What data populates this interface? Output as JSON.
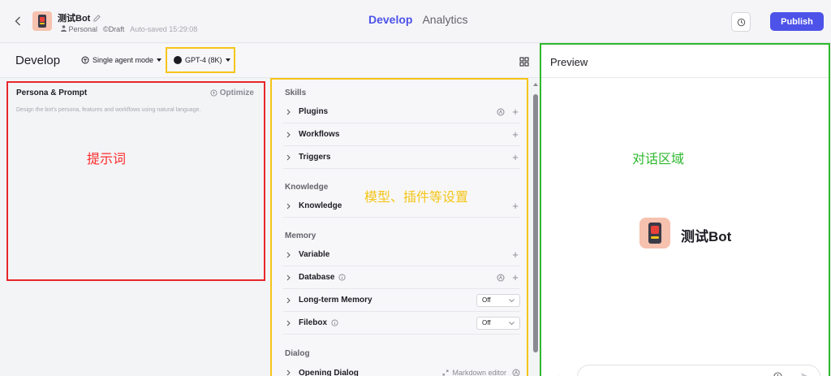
{
  "topbar": {
    "bot_name": "测试Bot",
    "workspace": "Personal",
    "status": "Draft",
    "autosave": "Auto-saved 15:29:08",
    "nav": [
      {
        "label": "Develop",
        "active": true
      },
      {
        "label": "Analytics",
        "active": false
      }
    ],
    "publish_label": "Publish",
    "accent_color": "#4d53e8"
  },
  "develop": {
    "title": "Develop",
    "mode": "Single agent mode",
    "model": "GPT-4 (8K)"
  },
  "prompt": {
    "title": "Persona & Prompt",
    "optimize_label": "Optimize",
    "placeholder": "Design the bot's persona, features and workflows using natural language.",
    "annotation": "提示词",
    "annotation_color": "#e8262b"
  },
  "settings": {
    "annotation": "模型、插件等设置",
    "annotation_color": "#f5c518",
    "sections": [
      {
        "title": "Skills",
        "items": [
          {
            "label": "Plugins",
            "auto": true,
            "add": true
          },
          {
            "label": "Workflows",
            "add": true
          },
          {
            "label": "Triggers",
            "add": true
          }
        ]
      },
      {
        "title": "Knowledge",
        "items": [
          {
            "label": "Knowledge",
            "add": true
          }
        ]
      },
      {
        "title": "Memory",
        "items": [
          {
            "label": "Variable",
            "add": true
          },
          {
            "label": "Database",
            "info": true,
            "auto": true,
            "add": true
          },
          {
            "label": "Long-term Memory",
            "toggle": "Off"
          },
          {
            "label": "Filebox",
            "info": true,
            "toggle": "Off"
          }
        ]
      },
      {
        "title": "Dialog",
        "items": [
          {
            "label": "Opening Dialog",
            "extra": "Markdown editor"
          }
        ]
      }
    ]
  },
  "preview": {
    "title": "Preview",
    "annotation": "对话区域",
    "annotation_color": "#2eb82e",
    "bot_name": "测试Bot"
  },
  "icons": {
    "back": "chevron-left-icon",
    "edit": "edit-icon",
    "history": "history-icon",
    "grid": "grid-icon",
    "optimize": "optimize-icon",
    "chevron": "chevron-right-icon",
    "add": "plus-icon",
    "auto": "auto-icon",
    "info": "info-icon",
    "mic": "mic-icon",
    "send": "send-icon"
  }
}
